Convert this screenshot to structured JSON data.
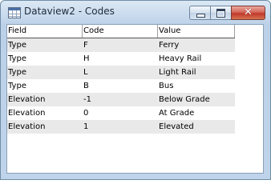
{
  "window": {
    "title": "Dataview2 - Codes",
    "close_glyph": "✕"
  },
  "icons": {
    "app": "table-icon",
    "minimize": "minimize-icon",
    "maximize": "maximize-icon",
    "close": "close-icon"
  },
  "colors": {
    "stripe": "#e9e9e9",
    "close_button": "#c0392b",
    "titlebar": "#c9dbee"
  },
  "table": {
    "columns": [
      "Field",
      "Code",
      "Value"
    ],
    "rows": [
      [
        "Type",
        "F",
        "Ferry"
      ],
      [
        "Type",
        "H",
        "Heavy Rail"
      ],
      [
        "Type",
        "L",
        "Light Rail"
      ],
      [
        "Type",
        "B",
        "Bus"
      ],
      [
        "Elevation",
        "-1",
        "Below Grade"
      ],
      [
        "Elevation",
        "0",
        "At Grade"
      ],
      [
        "Elevation",
        "1",
        "Elevated"
      ]
    ]
  }
}
